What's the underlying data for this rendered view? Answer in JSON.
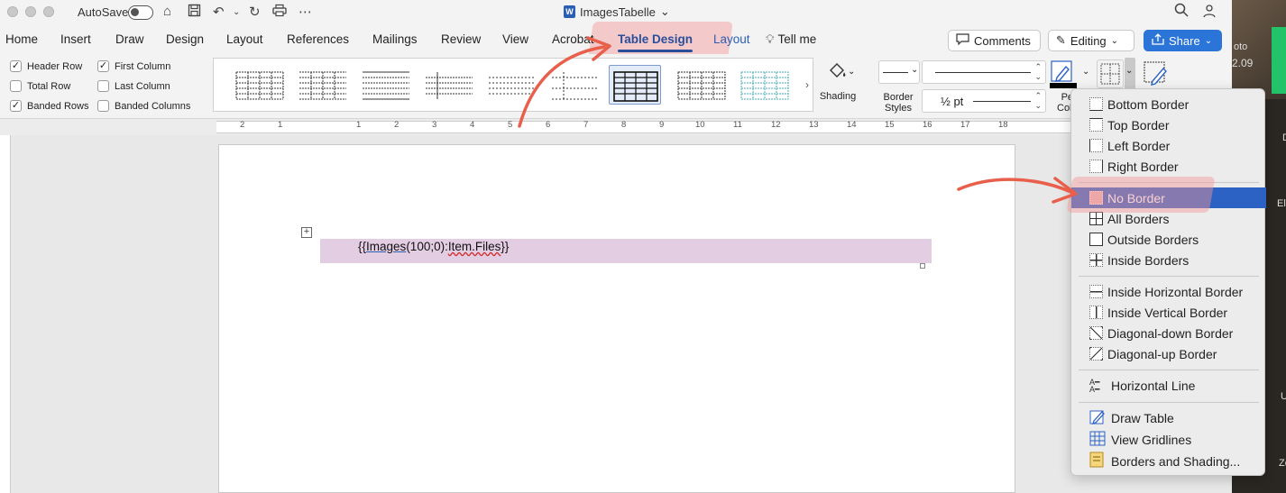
{
  "titlebar": {
    "autosave_label": "AutoSave",
    "document_title": "ImagesTabelle",
    "title_chevron": "⌄"
  },
  "tabs": [
    {
      "label": "Home"
    },
    {
      "label": "Insert"
    },
    {
      "label": "Draw"
    },
    {
      "label": "Design"
    },
    {
      "label": "Layout"
    },
    {
      "label": "References"
    },
    {
      "label": "Mailings"
    },
    {
      "label": "Review"
    },
    {
      "label": "View"
    },
    {
      "label": "Acrobat"
    },
    {
      "label": "Table Design"
    },
    {
      "label": "Layout"
    },
    {
      "label": "Tell me"
    }
  ],
  "actions": {
    "comments_label": "Comments",
    "editing_label": "Editing",
    "share_label": "Share"
  },
  "table_style_options": {
    "header_row": "Header Row",
    "total_row": "Total Row",
    "banded_rows": "Banded Rows",
    "first_column": "First Column",
    "last_column": "Last Column",
    "banded_columns": "Banded Columns",
    "checked": [
      "header_row",
      "banded_rows",
      "first_column"
    ]
  },
  "ribbon": {
    "shading_label": "Shading",
    "border_styles_label": "Border Styles",
    "pen_weight": "½ pt",
    "pen_color_label_partial": "Pe",
    "pen_color_label_partial2": "Colo",
    "gallery_more": "›"
  },
  "ruler": {
    "numbers": [
      "2",
      "1",
      "1",
      "2",
      "3",
      "4",
      "5",
      "6",
      "7",
      "8",
      "9",
      "10",
      "11",
      "12",
      "13",
      "14",
      "15",
      "16",
      "17",
      "18"
    ]
  },
  "document": {
    "field_prefix": "{{",
    "field_images": "Images",
    "field_args": "(100;0):",
    "field_item": "Item.Files",
    "field_suffix": "}}"
  },
  "border_menu": {
    "items": [
      {
        "label": "Bottom Border"
      },
      {
        "label": "Top Border"
      },
      {
        "label": "Left Border"
      },
      {
        "label": "Right Border"
      },
      {
        "label": "No Border",
        "selected": true
      },
      {
        "label": "All Borders"
      },
      {
        "label": "Outside Borders"
      },
      {
        "label": "Inside Borders"
      },
      {
        "label": "Inside Horizontal Border"
      },
      {
        "label": "Inside Vertical Border"
      },
      {
        "label": "Diagonal-down Border"
      },
      {
        "label": "Diagonal-up Border"
      },
      {
        "label": "Horizontal Line"
      },
      {
        "label": "Draw Table"
      },
      {
        "label": "View Gridlines"
      },
      {
        "label": "Borders and Shading..."
      }
    ]
  },
  "background_window": {
    "text_1": "oto",
    "text_2": "2.09",
    "text_3": "D",
    "text_4": "Ela",
    "text_5": "U",
    "text_6": "Ze"
  },
  "colors": {
    "accent": "#2b4e9b",
    "share": "#2b74d8",
    "menu_selected": "#2b62c3",
    "annotation_arrow": "#e8604c",
    "row_shading": "#e3cde3"
  }
}
